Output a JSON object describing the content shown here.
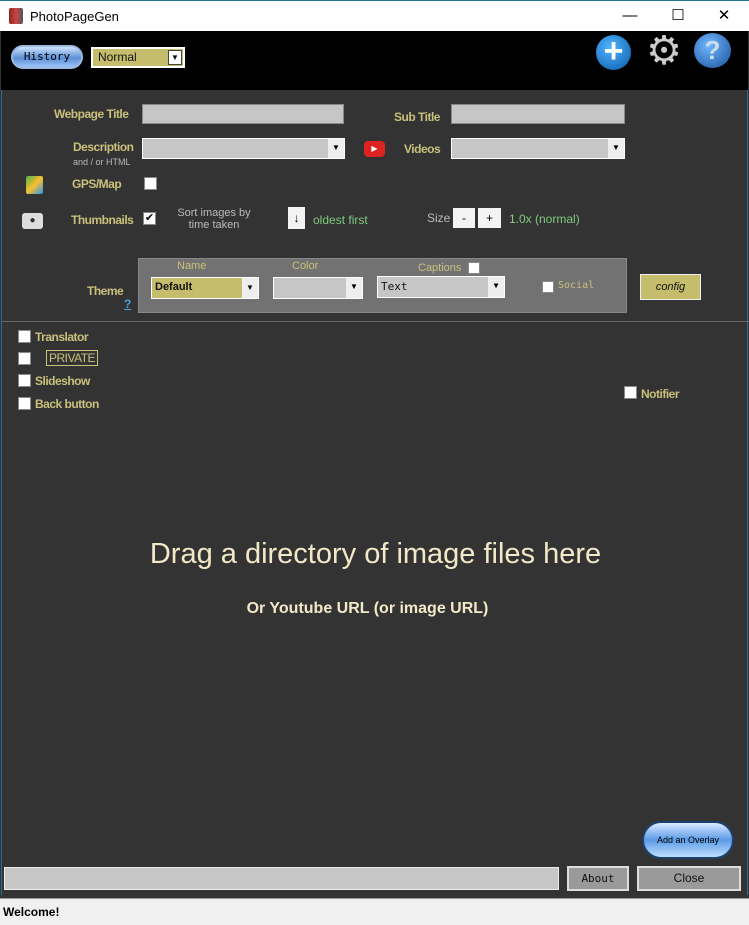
{
  "window": {
    "title": "PhotoPageGen",
    "minimize": "—",
    "maximize": "☐",
    "close": "✕"
  },
  "header": {
    "history_label": "History",
    "mode_select": "Normal",
    "icons": [
      "add-icon",
      "gear-icon",
      "help-icon"
    ]
  },
  "form": {
    "webpage_title_label": "Webpage Title",
    "webpage_title_value": "",
    "sub_title_label": "Sub Title",
    "sub_title_value": "",
    "description_label": "Description",
    "description_sub": "and / or HTML",
    "description_value": "",
    "videos_label": "Videos",
    "videos_value": "",
    "gps_label": "GPS/Map",
    "gps_checked": false,
    "thumbnails_label": "Thumbnails",
    "thumbnails_checked": true,
    "sort_label": "Sort images by time taken",
    "sort_arrow": "↓",
    "sort_order": "oldest first",
    "size_label": "Size",
    "size_minus": "-",
    "size_plus": "+",
    "size_value": "1.0x (normal)"
  },
  "theme": {
    "label": "Theme",
    "help": "?",
    "name_label": "Name",
    "name_value": "Default",
    "color_label": "Color",
    "color_value": "",
    "captions_label": "Captions",
    "captions_checked": false,
    "captions_value": "Text",
    "social_label": "Social",
    "social_checked": false,
    "config_label": "config"
  },
  "options": [
    {
      "label": "Translator",
      "checked": false
    },
    {
      "label": "PRIVATE",
      "checked": false
    },
    {
      "label": "Slideshow",
      "checked": false
    },
    {
      "label": "Back button",
      "checked": false
    },
    {
      "label": "Notifier",
      "checked": false
    }
  ],
  "dropzone": {
    "title": "Drag a directory of image files here",
    "subtitle": "Or Youtube URL (or image URL)"
  },
  "footer": {
    "overlay_label": "Add an Overlay",
    "url_value": "",
    "about_label": "About",
    "close_label": "Close"
  },
  "status": {
    "text": "Welcome!"
  },
  "colors": {
    "label": "#c9c07c",
    "accent_green": "#7fcb7f",
    "header_bg": "#000000",
    "main_bg": "#333333"
  }
}
